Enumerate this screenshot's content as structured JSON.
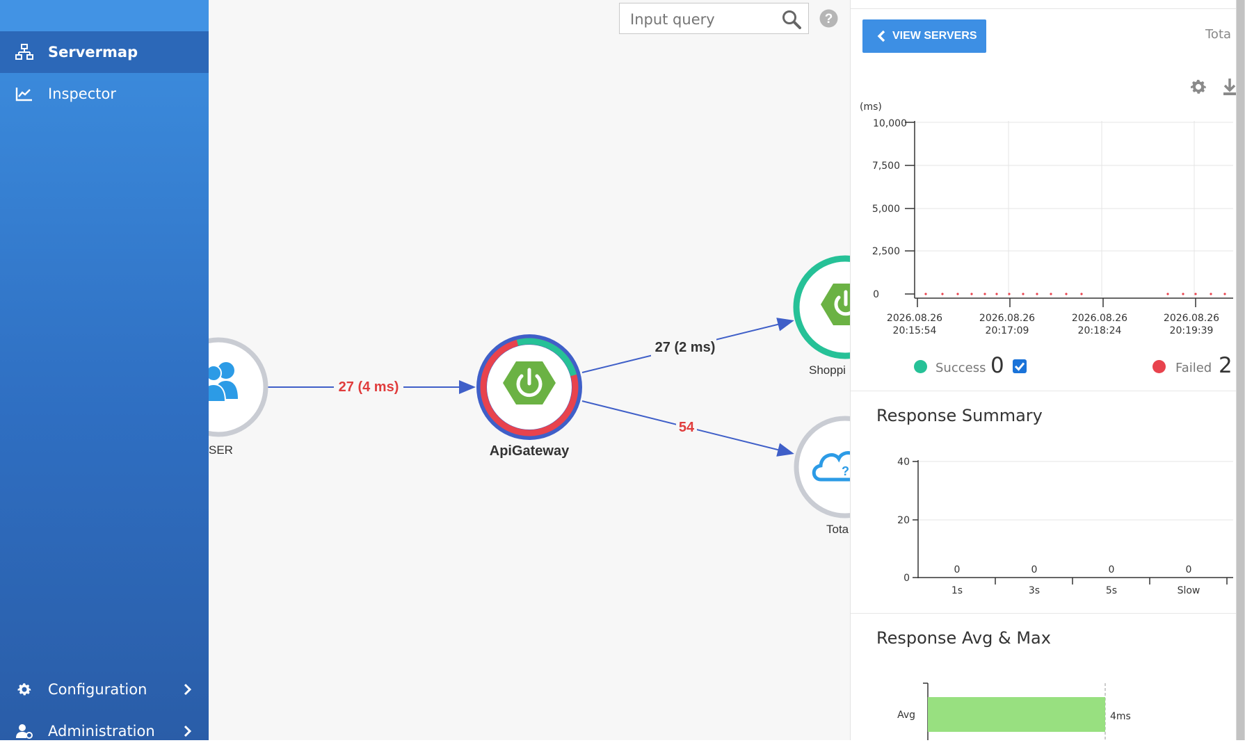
{
  "sidebar": {
    "items": [
      {
        "label": "Servermap",
        "icon": "servermap-icon"
      },
      {
        "label": "Inspector",
        "icon": "inspector-icon"
      }
    ],
    "bottom_items": [
      {
        "label": "Configuration",
        "icon": "gear-icon"
      },
      {
        "label": "Administration",
        "icon": "admin-icon"
      }
    ]
  },
  "search": {
    "placeholder": "Input query"
  },
  "servermap": {
    "nodes": [
      {
        "label": "SER"
      },
      {
        "label": "ApiGateway"
      },
      {
        "label": "Shoppi"
      },
      {
        "label": "Tota"
      }
    ],
    "edges": [
      {
        "label": "27 (4 ms)",
        "color": "#e03c3c"
      },
      {
        "label": "27 (2 ms)",
        "color": "#333333"
      },
      {
        "label": "54",
        "color": "#e03c3c"
      }
    ],
    "colors": {
      "accent": "#3d8fe4",
      "success": "#26c197",
      "failed": "#e8434d",
      "edge": "#3f5fc8"
    }
  },
  "panel": {
    "view_servers_label": "VIEW SERVERS",
    "total_label": "Tota",
    "scatter": {
      "unit": "(ms)",
      "y_ticks": [
        "10,000",
        "7,500",
        "5,000",
        "2,500",
        "0"
      ],
      "x_ticks": [
        {
          "date": "2026.08.26",
          "time": "20:15:54"
        },
        {
          "date": "2026.08.26",
          "time": "20:17:09"
        },
        {
          "date": "2026.08.26",
          "time": "20:18:24"
        },
        {
          "date": "2026.08.26",
          "time": "20:19:39"
        }
      ]
    },
    "legend": {
      "success_label": "Success",
      "success_value": "0",
      "failed_label": "Failed",
      "failed_value": "2"
    },
    "response_summary": {
      "title": "Response Summary",
      "categories": [
        "1s",
        "3s",
        "5s",
        "Slow"
      ],
      "values": [
        "0",
        "0",
        "0",
        "0"
      ],
      "y_ticks": [
        "40",
        "20",
        "0"
      ]
    },
    "response_avg_max": {
      "title": "Response Avg & Max",
      "avg_label": "Avg",
      "avg_value": "4ms"
    }
  }
}
